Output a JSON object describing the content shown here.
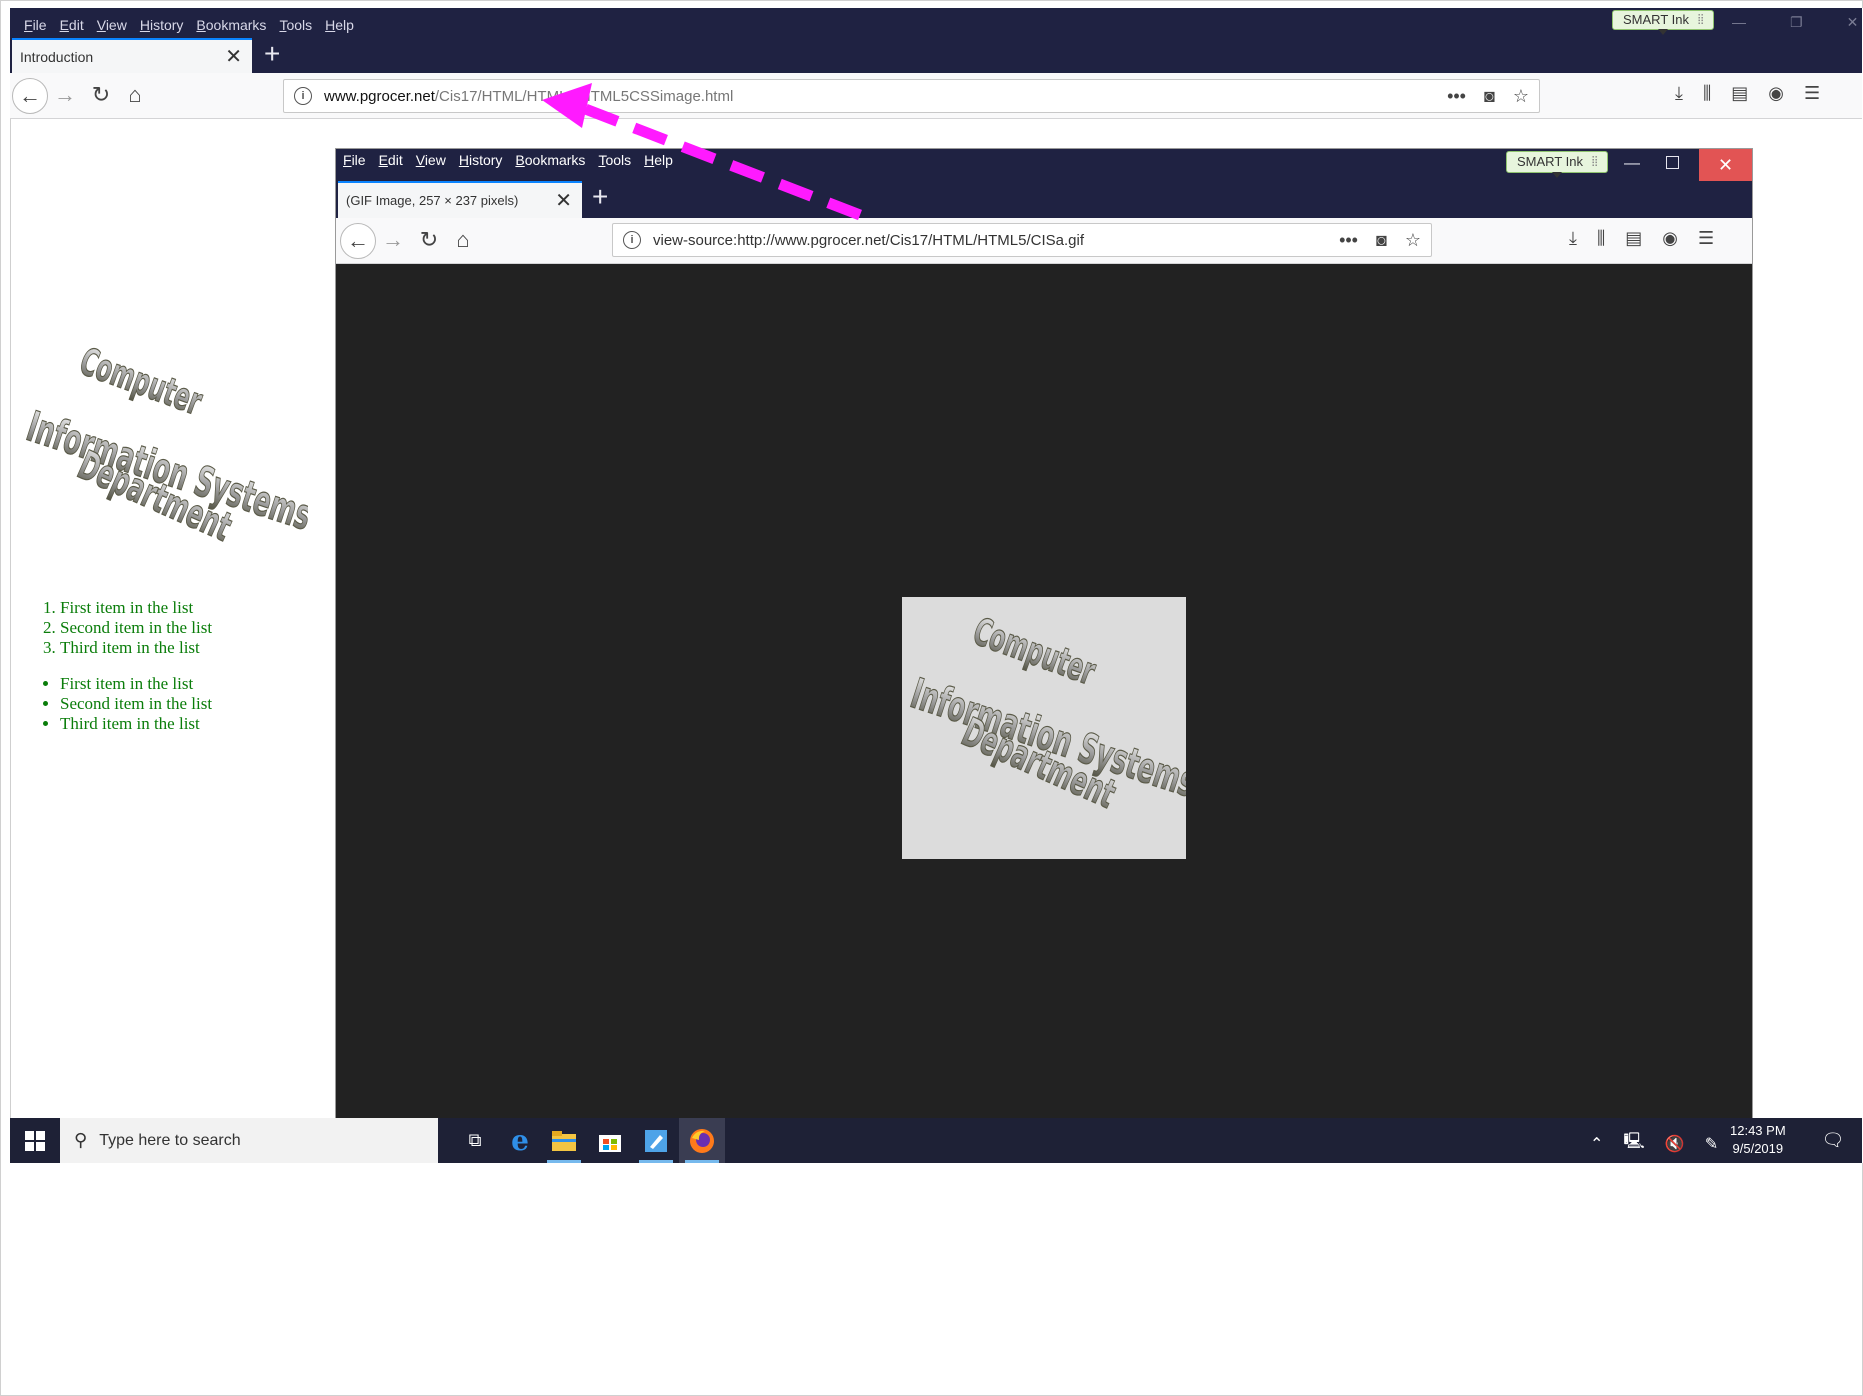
{
  "outer_browser": {
    "menu": [
      "File",
      "Edit",
      "View",
      "History",
      "Bookmarks",
      "Tools",
      "Help"
    ],
    "smart_ink": "SMART Ink",
    "tab_title": "Introduction",
    "url_domain": "www.pgrocer.net",
    "url_path": "/Cis17/HTML/HTML5/HTML5CSSimage.html"
  },
  "page": {
    "ordered_list": [
      "First item in the list",
      "Second item in the list",
      "Third item in the list"
    ],
    "unordered_list": [
      "First item in the list",
      "Second item in the list",
      "Third item in the list"
    ],
    "list_color": "#0a7d0a"
  },
  "logo_text": [
    "Computer",
    "Information Systems",
    "Department"
  ],
  "inner_browser": {
    "menu": [
      "File",
      "Edit",
      "View",
      "History",
      "Bookmarks",
      "Tools",
      "Help"
    ],
    "smart_ink": "SMART Ink",
    "tab_title": "(GIF Image, 257 × 237 pixels)",
    "url": "view-source:http://www.pgrocer.net/Cis17/HTML/HTML5/CISa.gif",
    "background": "#222222"
  },
  "annotation": {
    "arrow_color": "#ff1aff"
  },
  "taskbar": {
    "search_placeholder": "Type here to search",
    "time": "12:43 PM",
    "date": "9/5/2019"
  }
}
